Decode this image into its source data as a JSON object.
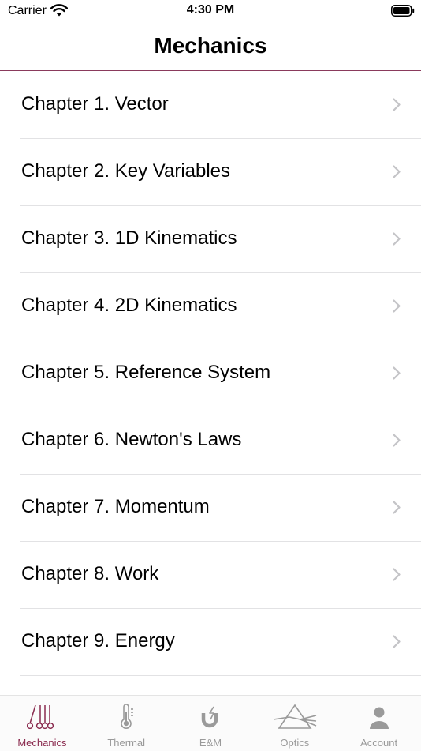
{
  "status_bar": {
    "carrier": "Carrier",
    "time": "4:30 PM"
  },
  "nav": {
    "title": "Mechanics"
  },
  "chapters": [
    {
      "label": "Chapter 1. Vector"
    },
    {
      "label": "Chapter 2. Key Variables"
    },
    {
      "label": "Chapter 3. 1D Kinematics"
    },
    {
      "label": "Chapter 4. 2D Kinematics"
    },
    {
      "label": "Chapter 5. Reference System"
    },
    {
      "label": "Chapter 6. Newton's Laws"
    },
    {
      "label": "Chapter 7. Momentum"
    },
    {
      "label": "Chapter 8. Work"
    },
    {
      "label": "Chapter 9. Energy"
    }
  ],
  "tabs": [
    {
      "label": "Mechanics",
      "icon": "newtons-cradle-icon",
      "active": true
    },
    {
      "label": "Thermal",
      "icon": "thermometer-icon"
    },
    {
      "label": "E&M",
      "icon": "magnet-icon"
    },
    {
      "label": "Optics",
      "icon": "prism-icon"
    },
    {
      "label": "Account",
      "icon": "person-icon"
    }
  ],
  "colors": {
    "accent": "#8a2a4e",
    "separator": "#e2e2e4",
    "chevron": "#c4c4c7",
    "inactive_tab": "#9a9a9a"
  }
}
